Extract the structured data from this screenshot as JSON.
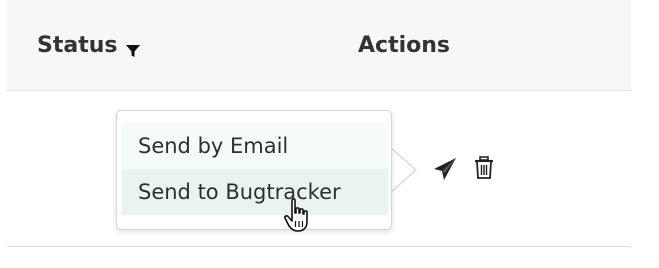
{
  "table": {
    "headers": {
      "status": "Status",
      "actions": "Actions"
    }
  },
  "icons": {
    "filter": "filter-icon",
    "send": "paper-plane-icon",
    "delete": "trash-icon",
    "cursor": "hand-pointer-cursor"
  },
  "popover": {
    "items": [
      {
        "label": "Send by Email"
      },
      {
        "label": "Send to Bugtracker"
      }
    ],
    "hovered_index": 1
  },
  "colors": {
    "header_background": "#f7f7f7",
    "hover_background": "#e8f3f2",
    "text": "#333333"
  }
}
